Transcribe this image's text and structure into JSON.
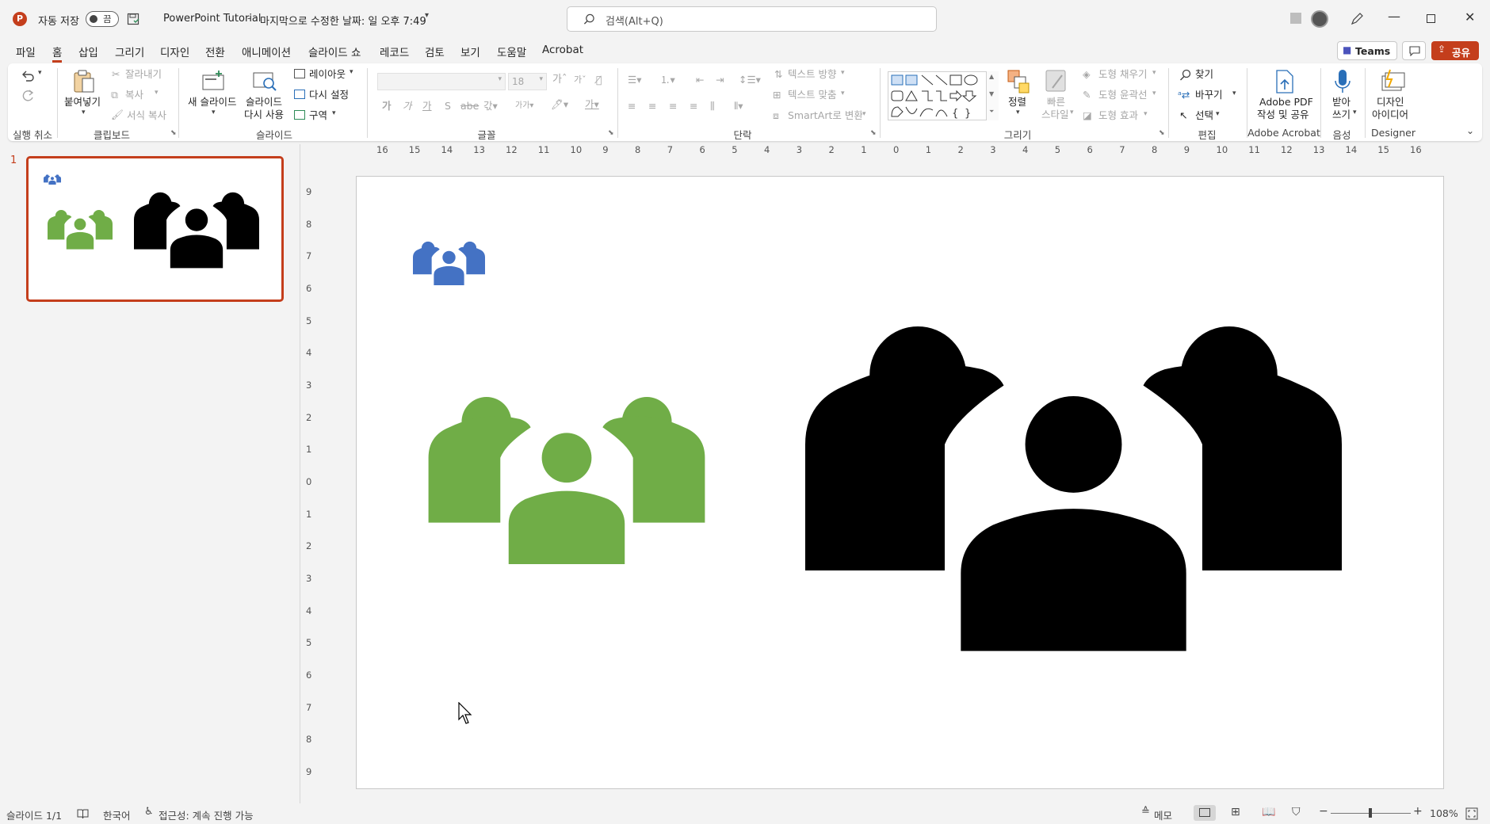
{
  "window": {
    "autosave_label": "자동 저장",
    "autosave_state": "끔",
    "file_title": "PowerPoint Tutorial",
    "modified_text": "마지막으로 수정한 날짜: 일 오후 7:49",
    "search_placeholder": "검색(Alt+Q)"
  },
  "menu": {
    "tabs": [
      "파일",
      "홈",
      "삽입",
      "그리기",
      "디자인",
      "전환",
      "애니메이션",
      "슬라이드 쇼",
      "레코드",
      "검토",
      "보기",
      "도움말",
      "Acrobat"
    ],
    "active_tab": "홈",
    "teams_label": "Teams",
    "share_label": "공유"
  },
  "ribbon": {
    "undo_group": "실행 취소",
    "clipboard": {
      "group": "클립보드",
      "paste": "붙여넣기",
      "cut": "잘라내기",
      "copy": "복사",
      "format_painter": "서식 복사"
    },
    "slides": {
      "group": "슬라이드",
      "new_slide": "새 슬라이드",
      "reuse_line1": "슬라이드",
      "reuse_line2": "다시 사용",
      "layout": "레이아웃",
      "reset": "다시 설정",
      "section": "구역"
    },
    "font": {
      "group": "글꼴",
      "size": "18"
    },
    "paragraph": {
      "group": "단락",
      "text_direction": "텍스트 방향",
      "align_text": "텍스트 맞춤",
      "smartart": "SmartArt로 변환"
    },
    "drawing": {
      "group": "그리기",
      "arrange": "정렬",
      "quick_styles_1": "빠른",
      "quick_styles_2": "스타일",
      "shape_fill": "도형 채우기",
      "shape_outline": "도형 윤곽선",
      "shape_effects": "도형 효과"
    },
    "editing": {
      "group": "편집",
      "find": "찾기",
      "replace": "바꾸기",
      "select": "선택"
    },
    "acrobat": {
      "group": "Adobe Acrobat",
      "line1": "Adobe PDF",
      "line2": "작성 및 공유"
    },
    "voice": {
      "group": "음성",
      "line1": "받아",
      "line2": "쓰기"
    },
    "designer": {
      "group": "Designer",
      "line1": "디자인",
      "line2": "아이디어"
    }
  },
  "slides_pane": {
    "slide_number": "1"
  },
  "ruler": {
    "h_numbers": [
      "16",
      "15",
      "14",
      "13",
      "12",
      "11",
      "10",
      "9",
      "8",
      "7",
      "6",
      "5",
      "4",
      "3",
      "2",
      "1",
      "0",
      "1",
      "2",
      "3",
      "4",
      "5",
      "6",
      "7",
      "8",
      "9",
      "10",
      "11",
      "12",
      "13",
      "14",
      "15",
      "16"
    ],
    "v_numbers": [
      "9",
      "8",
      "7",
      "6",
      "5",
      "4",
      "3",
      "2",
      "1",
      "0",
      "1",
      "2",
      "3",
      "4",
      "5",
      "6",
      "7",
      "8",
      "9"
    ]
  },
  "slide_icons": {
    "small": {
      "name": "people-group-icon",
      "color": "#4472c4"
    },
    "medium": {
      "name": "people-group-icon",
      "color": "#70ad47"
    },
    "large": {
      "name": "people-group-icon",
      "color": "#000000"
    }
  },
  "status": {
    "slide_info": "슬라이드 1/1",
    "language": "한국어",
    "accessibility": "접근성: 계속 진행 가능",
    "notes": "메모",
    "zoom": "108%"
  }
}
